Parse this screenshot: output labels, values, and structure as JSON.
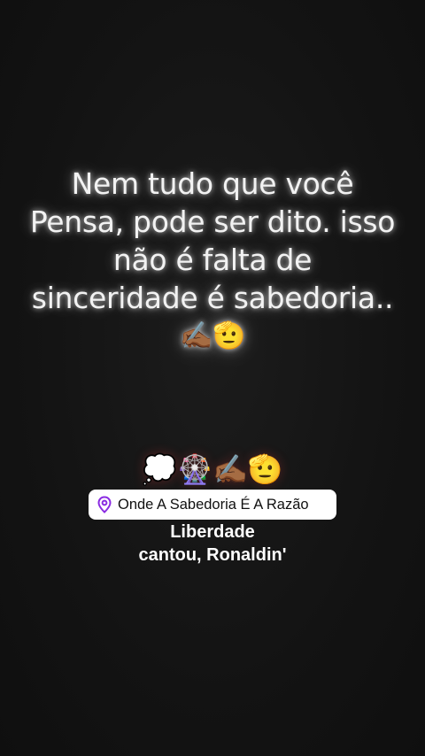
{
  "quote": {
    "lines": [
      "Nem tudo que você",
      "Pensa, pode ser dito. isso",
      "não é falta de",
      "sinceridade é sabedoria.."
    ],
    "emojis": "✍🏾🫡"
  },
  "sticker_emojis": "💭🎡✍🏾🫡",
  "location": {
    "icon": "location-pin-icon",
    "label": "Onde A Sabedoria É A Razão",
    "accent_color": "#8a2be2"
  },
  "music": {
    "line1": "Liberdade",
    "line2": "cantou, Ronaldin'"
  }
}
